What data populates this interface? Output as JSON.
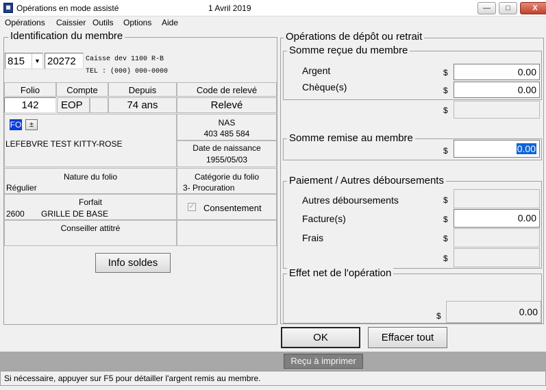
{
  "window": {
    "title": "Opérations en mode assisté",
    "date": "1  Avril  2019",
    "minimize": "—",
    "maximize": "□",
    "close": "X"
  },
  "menu": [
    "Opérations",
    "Caissier",
    "Outils",
    "Options",
    "Aide"
  ],
  "identification": {
    "legend": "Identification du membre",
    "branch_value": "815",
    "account_value": "20272",
    "caisse_line": "Caisse dev 1100 R-B",
    "tel_line": "TEL : (000) 000-0000",
    "headers": {
      "folio": "Folio",
      "compte": "Compte",
      "depuis": "Depuis",
      "code_releve": "Code de relevé"
    },
    "folio": "142",
    "compte": "EOP",
    "depuis": "74 ans",
    "code_releve": "Relevé",
    "tag_fo": "FO",
    "tag_plusminus": "±",
    "member_name": "LEFEBVRE TEST  KITTY-ROSE",
    "nas_label": "NAS",
    "nas_value": "403 485 584",
    "dob_label": "Date de naissance",
    "dob_value": "1955/05/03",
    "nature_label": "Nature du folio",
    "nature_value": "Régulier",
    "categorie_label": "Catégorie du folio",
    "categorie_value": "3- Procuration",
    "forfait_label": "Forfait",
    "forfait_code": "2600",
    "forfait_value": "GRILLE DE BASE",
    "consentement": "Consentement",
    "conseiller_label": "Conseiller attitré",
    "info_soldes_button": "Info soldes"
  },
  "operations": {
    "legend": "Opérations de dépôt ou retrait",
    "recue_legend": "Somme reçue du membre",
    "argent_label": "Argent",
    "argent_value": "0.00",
    "cheques_label": "Chèque(s)",
    "cheques_value": "0.00",
    "remise_legend": "Somme remise au membre",
    "remise_value": "0.00",
    "paiement_legend": "Paiement / Autres déboursements",
    "autres_label": "Autres déboursements",
    "facture_label": "Facture(s)",
    "facture_value": "0.00",
    "frais_label": "Frais",
    "effet_legend": "Effet net de l'opération",
    "effet_value": "0.00",
    "currency": "$"
  },
  "buttons": {
    "ok": "OK",
    "effacer": "Effacer tout",
    "recu": "Reçu à imprimer"
  },
  "status": "Si nécessaire, appuyer sur F5 pour détailler l'argent remis au membre."
}
